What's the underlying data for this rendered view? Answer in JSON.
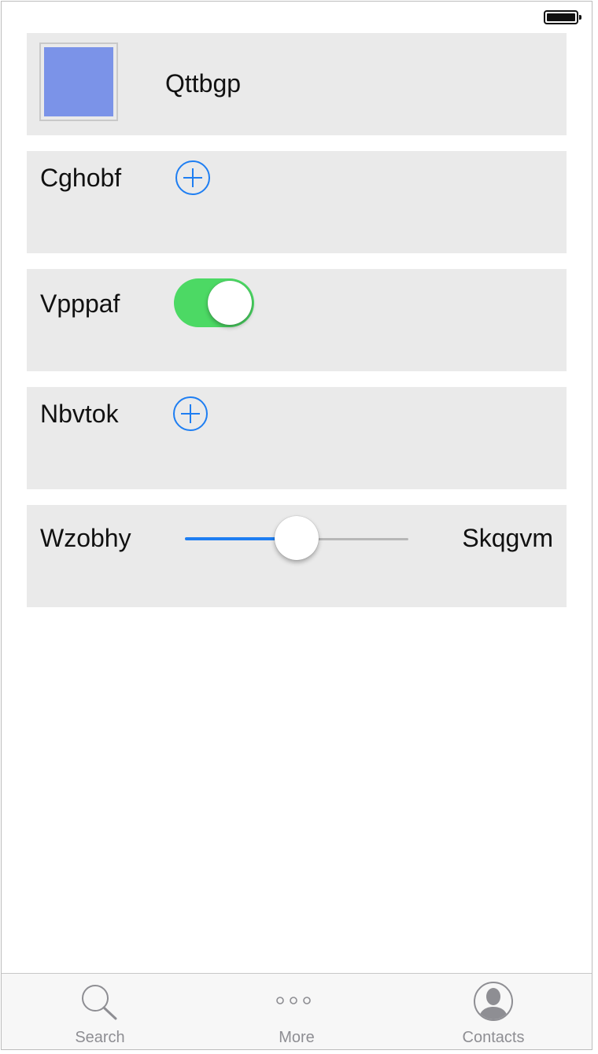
{
  "status_bar": {
    "battery_icon": "battery-full-icon"
  },
  "rows": {
    "color_row": {
      "label": "Qttbgp",
      "swatch_color": "#7b93e8"
    },
    "add_row_1": {
      "label": "Cghobf",
      "icon": "plus-circle-icon"
    },
    "toggle_row": {
      "label": "Vpppaf",
      "toggle_on": true,
      "on_color": "#4cd964"
    },
    "add_row_2": {
      "label": "Nbvtok",
      "icon": "plus-circle-icon"
    },
    "slider_row": {
      "min_label": "Wzobhy",
      "max_label": "Skqgvm",
      "value_fraction": 0.5
    }
  },
  "tab_bar": {
    "tabs": [
      {
        "label": "Search",
        "icon": "search-icon"
      },
      {
        "label": "More",
        "icon": "more-icon"
      },
      {
        "label": "Contacts",
        "icon": "contacts-icon"
      }
    ]
  },
  "colors": {
    "accent": "#1e7ef2",
    "row_background": "#eaeaea",
    "tab_label": "#8e8e93"
  }
}
